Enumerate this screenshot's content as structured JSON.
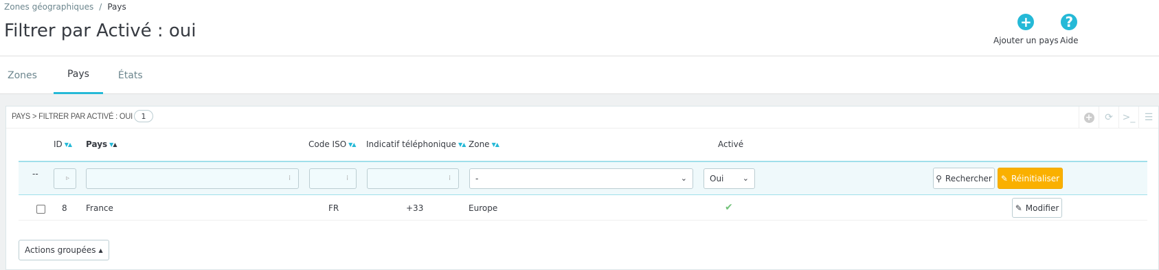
{
  "breadcrumb": {
    "parent": "Zones géographiques",
    "separator": "/",
    "current": "Pays"
  },
  "page_title": "Filtrer par Activé : oui",
  "toolbar": {
    "add_label": "Ajouter un pays",
    "help_label": "Aide",
    "add_icon_glyph": "+",
    "help_icon_glyph": "?"
  },
  "tabs": [
    {
      "label": "Zones",
      "active": false
    },
    {
      "label": "Pays",
      "active": true
    },
    {
      "label": "États",
      "active": false
    }
  ],
  "panel": {
    "title": "PAYS > FILTRER PAR ACTIVÉ : OUI",
    "count": "1",
    "tools": [
      "add-icon",
      "refresh-icon",
      "terminal-icon",
      "database-icon"
    ]
  },
  "table": {
    "columns": {
      "id": "ID",
      "name": "Pays",
      "iso": "Code ISO",
      "phone": "Indicatif téléphonique",
      "zone": "Zone",
      "active": "Activé"
    },
    "filters": {
      "row_marker": "--",
      "zone_value": "-",
      "active_value": "Oui",
      "search_label": "Rechercher",
      "reset_label": "Réinitialiser"
    },
    "rows": [
      {
        "id": "8",
        "name": "France",
        "iso": "FR",
        "phone": "+33",
        "zone": "Europe",
        "active_mark": "✔",
        "edit_label": "Modifier"
      }
    ]
  },
  "bulk_actions_label": "Actions groupées",
  "colors": {
    "accent": "#25b9d7",
    "warning": "#fab000",
    "success": "#72c279"
  }
}
